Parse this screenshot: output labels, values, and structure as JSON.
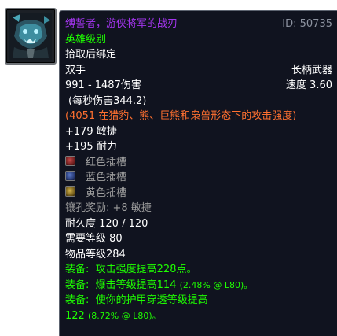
{
  "icon": {
    "name": "polearm-beast-head-icon",
    "accent": "#6fd3e6"
  },
  "item": {
    "name": "缚誓者，游侠将军的战刃",
    "id": "ID: 50735",
    "quality_color": "#a335ee",
    "difficulty": "英雄级别",
    "bind": "拾取后绑定",
    "hand": "双手",
    "type": "长柄武器",
    "damage": "991 - 1487伤害",
    "speed": "速度 3.60",
    "dps": "(每秒伤害344.2)",
    "feral_ap": "(4051 在猎豹、熊、巨熊和枭兽形态下的攻击强度)",
    "stats": [
      "+179 敏捷",
      "+195 耐力"
    ],
    "sockets": [
      {
        "color": "red",
        "label": "红色插槽"
      },
      {
        "color": "blue",
        "label": "蓝色插槽"
      },
      {
        "color": "yellow",
        "label": "黄色插槽"
      }
    ],
    "socket_bonus": "镶孔奖励: +8 敏捷",
    "durability": "耐久度 120 / 120",
    "required_level": "需要等级 80",
    "item_level": "物品等级284",
    "equip": [
      {
        "prefix": "装备:",
        "text": "攻击强度提高228点。",
        "extra": ""
      },
      {
        "prefix": "装备:",
        "text": "爆击等级提高114",
        "extra": "(2.48% @ L80)。"
      },
      {
        "prefix": "装备:",
        "text": "使你的护甲穿透等级提高",
        "extra": ""
      }
    ],
    "equip_cont": {
      "text": "122",
      "extra": "(8.72% @ L80)。"
    }
  }
}
